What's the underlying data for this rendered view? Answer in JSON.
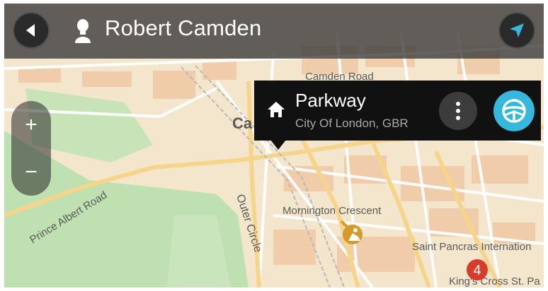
{
  "header": {
    "contact_name": "Robert Camden",
    "back_icon": "back-arrow-icon",
    "contact_icon": "contact-person-icon",
    "navigation_icon": "navigation-arrow-icon"
  },
  "map": {
    "labels": {
      "camden_road": "Camden Road",
      "camden_partial": "Ca",
      "prince_albert_road": "Prince Albert Road",
      "outer_circle": "Outer Circle",
      "mornington_crescent": "Mornington Crescent",
      "saint_pancras": "Saint Pancras Internation",
      "kings_cross": "King's Cross St. Pa"
    },
    "poi_badge_number": "4",
    "colors": {
      "land": "#f3e6cc",
      "park": "#bfe0b0",
      "roads": "#ffffff",
      "major_roads": "#f6d58a",
      "buildings": "#efc49f",
      "badge": "#d83b2a"
    }
  },
  "zoom": {
    "in_label": "+",
    "out_label": "−"
  },
  "popup": {
    "name": "Parkway",
    "address": "City Of London, GBR",
    "icon": "home-icon",
    "more_icon": "more-options-icon",
    "drive_icon": "steering-wheel-icon",
    "drive_color": "#36b7dc"
  }
}
